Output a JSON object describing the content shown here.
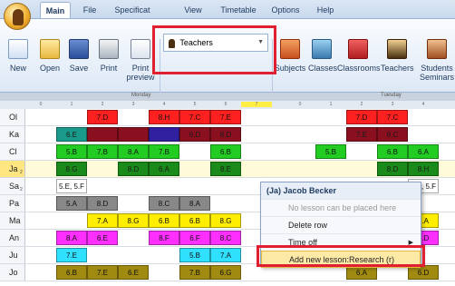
{
  "ribbon": {
    "tabs": [
      {
        "label": "Main"
      },
      {
        "label": "File"
      },
      {
        "label": "Specificat"
      },
      {
        "label": "View"
      },
      {
        "label": "Timetable"
      },
      {
        "label": "Options"
      },
      {
        "label": "Help"
      }
    ],
    "buttons": {
      "new": "New",
      "open": "Open",
      "save": "Save",
      "print": "Print",
      "print_preview_1": "Print",
      "print_preview_2": "preview",
      "subjects": "Subjects",
      "classes": "Classes",
      "classrooms": "Classrooms",
      "teachers": "Teachers",
      "students_1": "Students",
      "students_2": "Seminars"
    },
    "combo_value": "Teachers"
  },
  "grid": {
    "days": [
      "Monday",
      "Tuesday"
    ],
    "periods_day1": [
      "0",
      "1",
      "2",
      "3",
      "4",
      "5",
      "6",
      "7"
    ],
    "periods_day2": [
      "0",
      "1",
      "2",
      "3",
      "4"
    ],
    "rows": [
      {
        "label": "Ol",
        "sub": ""
      },
      {
        "label": "Ka",
        "sub": ""
      },
      {
        "label": "Cl",
        "sub": ""
      },
      {
        "label": "Ja",
        "sub": "2"
      },
      {
        "label": "Sa",
        "sub": "2"
      },
      {
        "label": "Pa",
        "sub": ""
      },
      {
        "label": "Ma",
        "sub": ""
      },
      {
        "label": "An",
        "sub": ""
      },
      {
        "label": "Ju",
        "sub": ""
      },
      {
        "label": "Jo",
        "sub": ""
      }
    ],
    "cells": [
      {
        "row": 0,
        "col": 2,
        "text": "7.D",
        "color": "#ff2020"
      },
      {
        "row": 0,
        "col": 4,
        "text": "8.H",
        "color": "#ff2020"
      },
      {
        "row": 0,
        "col": 5,
        "text": "7.C",
        "color": "#ff2020"
      },
      {
        "row": 0,
        "col": 6,
        "text": "7.E",
        "color": "#ff2020"
      },
      {
        "row": 0,
        "col": 10,
        "text": "7.D",
        "color": "#ff2020"
      },
      {
        "row": 0,
        "col": 11,
        "text": "7.C",
        "color": "#ff2020"
      },
      {
        "row": 1,
        "col": 1,
        "text": "6.E",
        "color": "#1a9a8a"
      },
      {
        "row": 1,
        "col": 2,
        "text": "",
        "color": "#8a1020"
      },
      {
        "row": 1,
        "col": 3,
        "text": "",
        "color": "#8a1020"
      },
      {
        "row": 1,
        "col": 4,
        "text": "",
        "color": "#3020a0"
      },
      {
        "row": 1,
        "col": 5,
        "text": "6.D",
        "color": "#8a1020"
      },
      {
        "row": 1,
        "col": 6,
        "text": "8.D",
        "color": "#8a1020"
      },
      {
        "row": 1,
        "col": 10,
        "text": "7.E",
        "color": "#8a1020"
      },
      {
        "row": 1,
        "col": 11,
        "text": "6.C",
        "color": "#8a1020"
      },
      {
        "row": 2,
        "col": 1,
        "text": "5.B",
        "color": "#22cc22"
      },
      {
        "row": 2,
        "col": 2,
        "text": "7.B",
        "color": "#22cc22"
      },
      {
        "row": 2,
        "col": 3,
        "text": "8.A",
        "color": "#22cc22"
      },
      {
        "row": 2,
        "col": 4,
        "text": "7.B",
        "color": "#22cc22"
      },
      {
        "row": 2,
        "col": 6,
        "text": "6.B",
        "color": "#22cc22"
      },
      {
        "row": 2,
        "col": 9,
        "text": "5.B",
        "color": "#22cc22"
      },
      {
        "row": 2,
        "col": 11,
        "text": "6.B",
        "color": "#22cc22"
      },
      {
        "row": 2,
        "col": 12,
        "text": "6.A",
        "color": "#22cc22"
      },
      {
        "row": 3,
        "col": 1,
        "text": "8.G",
        "color": "#1a8a1a"
      },
      {
        "row": 3,
        "col": 3,
        "text": "8.D",
        "color": "#1a8a1a"
      },
      {
        "row": 3,
        "col": 4,
        "text": "6.A",
        "color": "#1a8a1a"
      },
      {
        "row": 3,
        "col": 6,
        "text": "8.E",
        "color": "#1a8a1a"
      },
      {
        "row": 3,
        "col": 11,
        "text": "8.D",
        "color": "#1a8a1a"
      },
      {
        "row": 3,
        "col": 12,
        "text": "8.H",
        "color": "#1a8a1a"
      },
      {
        "row": 4,
        "col": 1,
        "text": "5.E, 5.F",
        "color": "#ffffff"
      },
      {
        "row": 4,
        "col": 12,
        "text": "5.E, 5.F",
        "color": "#ffffff"
      },
      {
        "row": 5,
        "col": 1,
        "text": "5.A",
        "color": "#888888"
      },
      {
        "row": 5,
        "col": 2,
        "text": "8.D",
        "color": "#888888"
      },
      {
        "row": 5,
        "col": 4,
        "text": "8.C",
        "color": "#888888"
      },
      {
        "row": 5,
        "col": 5,
        "text": "8.A",
        "color": "#888888"
      },
      {
        "row": 6,
        "col": 2,
        "text": "7.A",
        "color": "#ffee00"
      },
      {
        "row": 6,
        "col": 3,
        "text": "8.G",
        "color": "#ffee00"
      },
      {
        "row": 6,
        "col": 4,
        "text": "6.B",
        "color": "#ffee00"
      },
      {
        "row": 6,
        "col": 5,
        "text": "6.B",
        "color": "#ffee00"
      },
      {
        "row": 6,
        "col": 6,
        "text": "8.G",
        "color": "#ffee00"
      },
      {
        "row": 6,
        "col": 12,
        "text": "7.A",
        "color": "#ffee00"
      },
      {
        "row": 7,
        "col": 1,
        "text": "8.A",
        "color": "#ff30ff"
      },
      {
        "row": 7,
        "col": 2,
        "text": "6.E",
        "color": "#ff30ff"
      },
      {
        "row": 7,
        "col": 4,
        "text": "8.F",
        "color": "#ff30ff"
      },
      {
        "row": 7,
        "col": 5,
        "text": "6.F",
        "color": "#ff30ff"
      },
      {
        "row": 7,
        "col": 6,
        "text": "8.C",
        "color": "#ff30ff"
      },
      {
        "row": 7,
        "col": 12,
        "text": "5.D",
        "color": "#ff30ff"
      },
      {
        "row": 8,
        "col": 1,
        "text": "7.E",
        "color": "#30e0ff"
      },
      {
        "row": 8,
        "col": 5,
        "text": "5.B",
        "color": "#30e0ff"
      },
      {
        "row": 8,
        "col": 6,
        "text": "7.A",
        "color": "#30e0ff"
      },
      {
        "row": 9,
        "col": 1,
        "text": "6.B",
        "color": "#a08a10"
      },
      {
        "row": 9,
        "col": 2,
        "text": "7.E",
        "color": "#a08a10"
      },
      {
        "row": 9,
        "col": 3,
        "text": "6.E",
        "color": "#a08a10"
      },
      {
        "row": 9,
        "col": 5,
        "text": "7.B",
        "color": "#a08a10"
      },
      {
        "row": 9,
        "col": 6,
        "text": "6.G",
        "color": "#a08a10"
      },
      {
        "row": 9,
        "col": 10,
        "text": "6.A",
        "color": "#a08a10"
      },
      {
        "row": 9,
        "col": 12,
        "text": "6.D",
        "color": "#a08a10"
      }
    ]
  },
  "context_menu": {
    "title": "(Ja) Jacob Becker",
    "items": [
      {
        "label": "No lesson can be placed here"
      },
      {
        "label": "Delete row"
      },
      {
        "label": "Time off"
      },
      {
        "label": "Add new lesson:Research (r)"
      }
    ]
  }
}
